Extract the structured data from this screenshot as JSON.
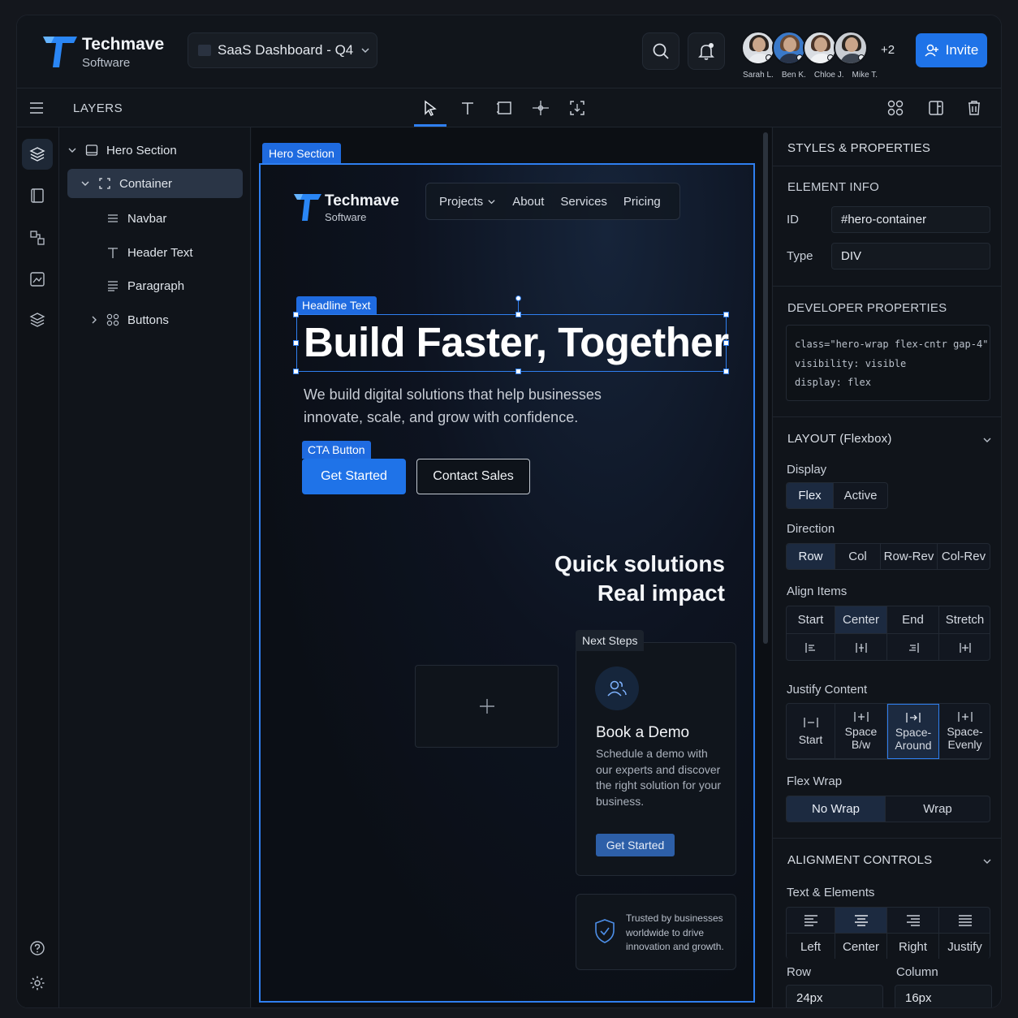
{
  "brand": {
    "name": "Techmave",
    "sub": "Software"
  },
  "project": {
    "title": "SaaS Dashboard - Q4"
  },
  "collaborators": {
    "names": [
      "Sarah L.",
      "Ben K.",
      "Chloe J.",
      "Mike T."
    ],
    "extra": "+2"
  },
  "invite_label": "Invite",
  "toolbar": {
    "layers_title": "LAYERS"
  },
  "layers": [
    {
      "label": "Hero Section"
    },
    {
      "label": "Container"
    },
    {
      "label": "Navbar"
    },
    {
      "label": "Header Text"
    },
    {
      "label": "Paragraph"
    },
    {
      "label": "Buttons"
    }
  ],
  "canvas": {
    "frame_tag": "Hero Section",
    "hero_brand": {
      "name": "Techmave",
      "sub": "Software"
    },
    "nav": [
      "Projects",
      "About",
      "Services",
      "Pricing"
    ],
    "headline_tag": "Headline Text",
    "headline": "Build Faster, Together",
    "paragraph": "We build digital solutions that help businesses innovate, scale, and grow with confidence.",
    "cta_tag": "CTA Button",
    "primary_btn": "Get Started",
    "secondary_btn": "Contact Sales",
    "quick_line1": "Quick solutions",
    "quick_line2": "Real impact",
    "next_tag": "Next Steps",
    "demo_title": "Book a Demo",
    "demo_text": "Schedule a demo with our experts and discover the right solution for your business.",
    "demo_btn": "Get Started",
    "trust_text": "Trusted by businesses worldwide to drive innovation and growth."
  },
  "panel": {
    "title": "STYLES & PROPERTIES",
    "element_info": "ELEMENT INFO",
    "id_label": "ID",
    "id_value": "#hero-container",
    "type_label": "Type",
    "type_value": "DIV",
    "dev_props": "DEVELOPER PROPERTIES",
    "code": "class=\"hero-wrap flex-cntr gap-4\"\nvisibility: visible\ndisplay: flex",
    "layout_title": "LAYOUT (Flexbox)",
    "display_label": "Display",
    "display_options": [
      "Flex",
      "Active"
    ],
    "direction_label": "Direction",
    "direction_options": [
      "Row",
      "Col",
      "Row-Rev",
      "Col-Rev"
    ],
    "align_label": "Align Items",
    "align_options": [
      "Start",
      "Center",
      "End",
      "Stretch"
    ],
    "justify_label": "Justify Content",
    "justify_options": [
      "Start",
      "Space B/w",
      "Space-Around",
      "Space-Evenly"
    ],
    "wrap_label": "Flex Wrap",
    "wrap_options": [
      "No Wrap",
      "Wrap"
    ],
    "alignment_title": "ALIGNMENT CONTROLS",
    "text_label": "Text & Elements",
    "text_options": [
      "Left",
      "Center",
      "Right",
      "Justify"
    ],
    "row_label": "Row",
    "row_value": "24px",
    "col_label": "Column",
    "col_value": "16px"
  },
  "colors": {
    "accent": "#1f73e8",
    "selection": "#2f7ff0",
    "bg": "#0f1217"
  }
}
